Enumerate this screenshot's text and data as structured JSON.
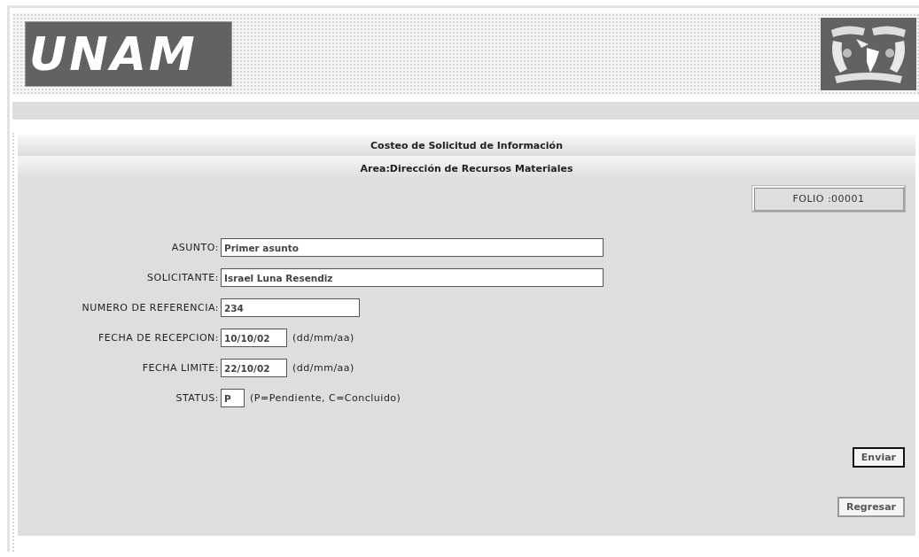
{
  "header": {
    "logo_text": "UNAM"
  },
  "form": {
    "title": "Costeo de Solicitud de Información",
    "subtitle": "Area:Dirección de Recursos Materiales",
    "folio": "FOLIO :00001",
    "fields": [
      {
        "label": "ASUNTO:",
        "value": "Primer asunto",
        "kind": "long"
      },
      {
        "label": "SOLICITANTE:",
        "value": "Israel Luna Resendiz",
        "kind": "long"
      },
      {
        "label": "NUMERO DE REFERENCIA:",
        "value": "234",
        "kind": "medium"
      },
      {
        "label": "FECHA DE RECEPCION:",
        "value": "10/10/02",
        "kind": "date",
        "hint": "(dd/mm/aa)"
      },
      {
        "label": "FECHA LIMITE:",
        "value": "22/10/02",
        "kind": "date",
        "hint": "(dd/mm/aa)"
      },
      {
        "label": "STATUS:",
        "value": "P",
        "kind": "code",
        "hint": "(P=Pendiente, C=Concluido)"
      }
    ],
    "buttons": [
      {
        "label": "Enviar",
        "focused": true
      },
      {
        "label": "Regresar",
        "focused": false
      }
    ]
  }
}
